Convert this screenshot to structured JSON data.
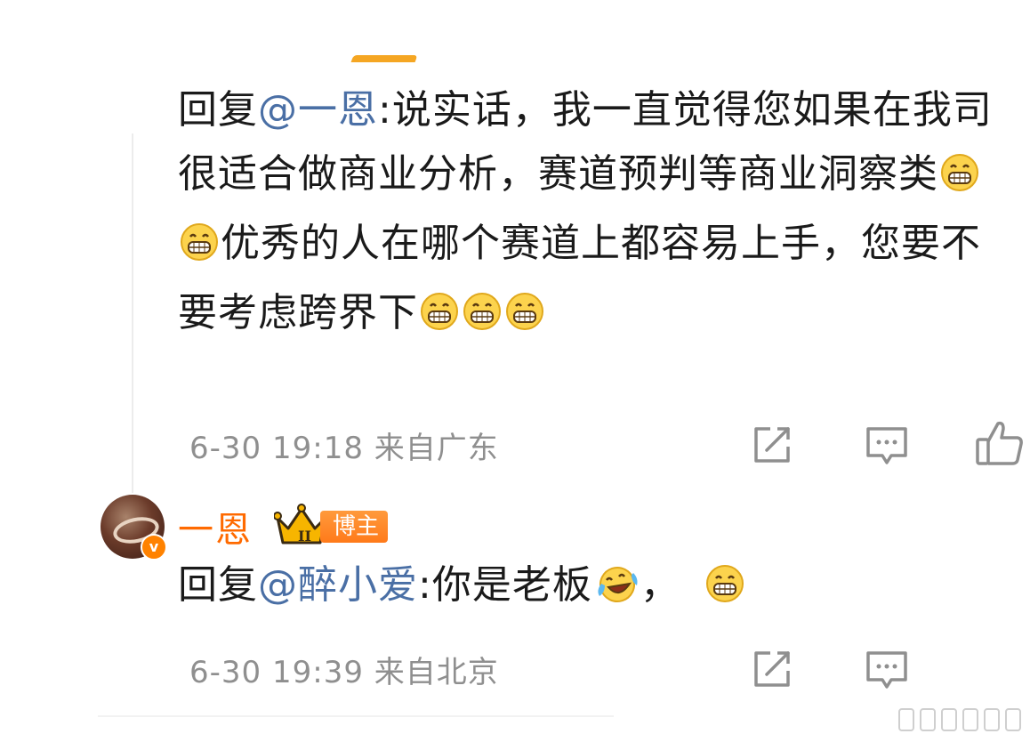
{
  "comment1": {
    "reply_prefix": "回复",
    "mention": "@一恩",
    "text_part1": ":说实话，我一直觉得您如果在我司很适合做商业分析，赛道预判等商业洞察类",
    "text_part2": "优秀的人在哪个赛道上都容易上手，您要不要考虑跨界下",
    "emojis": [
      "grin-emoji",
      "grin-emoji",
      "grin-emoji",
      "grin-emoji",
      "grin-emoji"
    ],
    "meta": "6-30 19:18 来自广东"
  },
  "comment2": {
    "username": "一恩",
    "role_badge": "博主",
    "crown_level": "II",
    "reply_prefix": "回复",
    "mention": "@醉小爱",
    "text_part1": ":你是老板",
    "text_part2": "，",
    "emojis": [
      "laugh-cry-emoji",
      "grin-emoji"
    ],
    "meta": "6-30 19:39 来自北京"
  },
  "colors": {
    "mention": "#4a6fa5",
    "username": "#ff6a00",
    "meta": "#8f8f8f",
    "badge": "#ff8200"
  }
}
